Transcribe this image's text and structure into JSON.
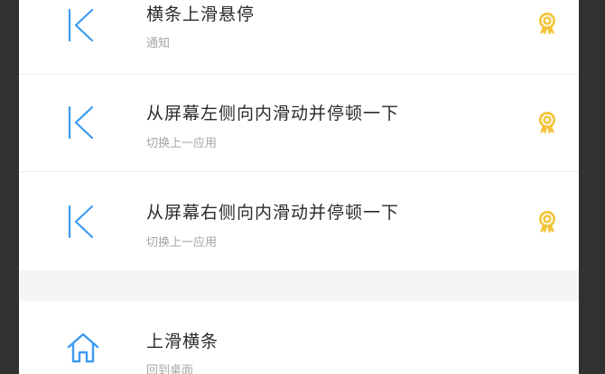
{
  "gestures": [
    {
      "title": "横条上滑悬停",
      "subtitle": "通知",
      "icon": "back-chevron-icon",
      "badge": "medal-icon"
    },
    {
      "title": "从屏幕左侧向内滑动并停顿一下",
      "subtitle": "切换上一应用",
      "icon": "back-chevron-icon",
      "badge": "medal-icon"
    },
    {
      "title": "从屏幕右侧向内滑动并停顿一下",
      "subtitle": "切换上一应用",
      "icon": "back-chevron-icon",
      "badge": "medal-icon"
    },
    {
      "title": "上滑横条",
      "subtitle": "回到桌面",
      "icon": "home-icon"
    }
  ],
  "colors": {
    "icon_blue": "#3d9bf0",
    "badge_gold": "#f3c33a",
    "title_text": "#2b2b2b",
    "subtitle_text": "#a6a6a6",
    "section_gap": "#f4f5f6",
    "frame": "#2f3230"
  }
}
